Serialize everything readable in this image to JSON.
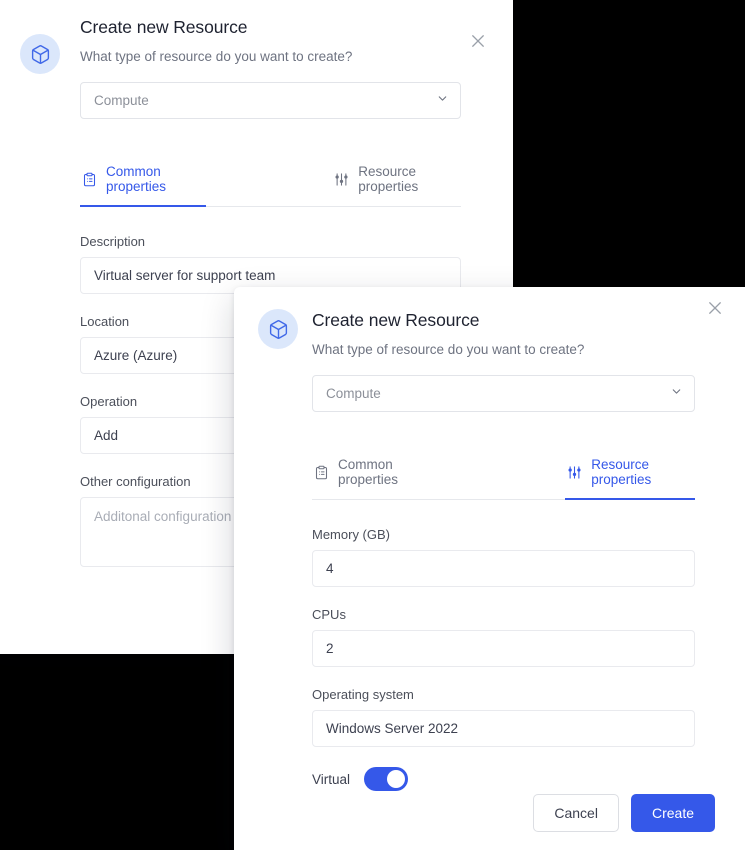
{
  "theme": {
    "accent": "#3558e9",
    "avatar_bg": "#dbe7fb",
    "backdrop": "#000000",
    "text_primary": "#1e2230",
    "text_muted": "#6e7381",
    "border": "#e2e4e9"
  },
  "back_dialog": {
    "icon": "cube-icon",
    "title": "Create new Resource",
    "subtitle": "What type of resource do you want to create?",
    "close_icon": "close-icon",
    "resource_type": {
      "value": "Compute",
      "chevron_icon": "chevron-down-icon"
    },
    "tabs": [
      {
        "label": "Common properties",
        "icon": "clipboard-list-icon",
        "active": true
      },
      {
        "label": "Resource properties",
        "icon": "sliders-icon",
        "active": false
      }
    ],
    "fields": [
      {
        "label": "Description",
        "value": "Virtual server for support team",
        "placeholder": "",
        "type": "text"
      },
      {
        "label": "Location",
        "value": "Azure (Azure)",
        "placeholder": "",
        "type": "text"
      },
      {
        "label": "Operation",
        "value": "Add",
        "placeholder": "",
        "type": "text"
      },
      {
        "label": "Other configuration",
        "value": "",
        "placeholder": "Additonal configuration",
        "type": "textarea"
      }
    ]
  },
  "front_dialog": {
    "icon": "cube-icon",
    "title": "Create new Resource",
    "subtitle": "What type of resource do you want to create?",
    "close_icon": "close-icon",
    "resource_type": {
      "value": "Compute",
      "chevron_icon": "chevron-down-icon"
    },
    "tabs": [
      {
        "label": "Common properties",
        "icon": "clipboard-list-icon",
        "active": false
      },
      {
        "label": "Resource properties",
        "icon": "sliders-icon",
        "active": true
      }
    ],
    "fields": [
      {
        "label": "Memory (GB)",
        "value": "4",
        "placeholder": "",
        "type": "text"
      },
      {
        "label": "CPUs",
        "value": "2",
        "placeholder": "",
        "type": "text"
      },
      {
        "label": "Operating system",
        "value": "Windows Server 2022",
        "placeholder": "",
        "type": "text"
      }
    ],
    "toggle": {
      "label": "Virtual",
      "checked": true
    },
    "footer": {
      "cancel_label": "Cancel",
      "create_label": "Create"
    }
  }
}
